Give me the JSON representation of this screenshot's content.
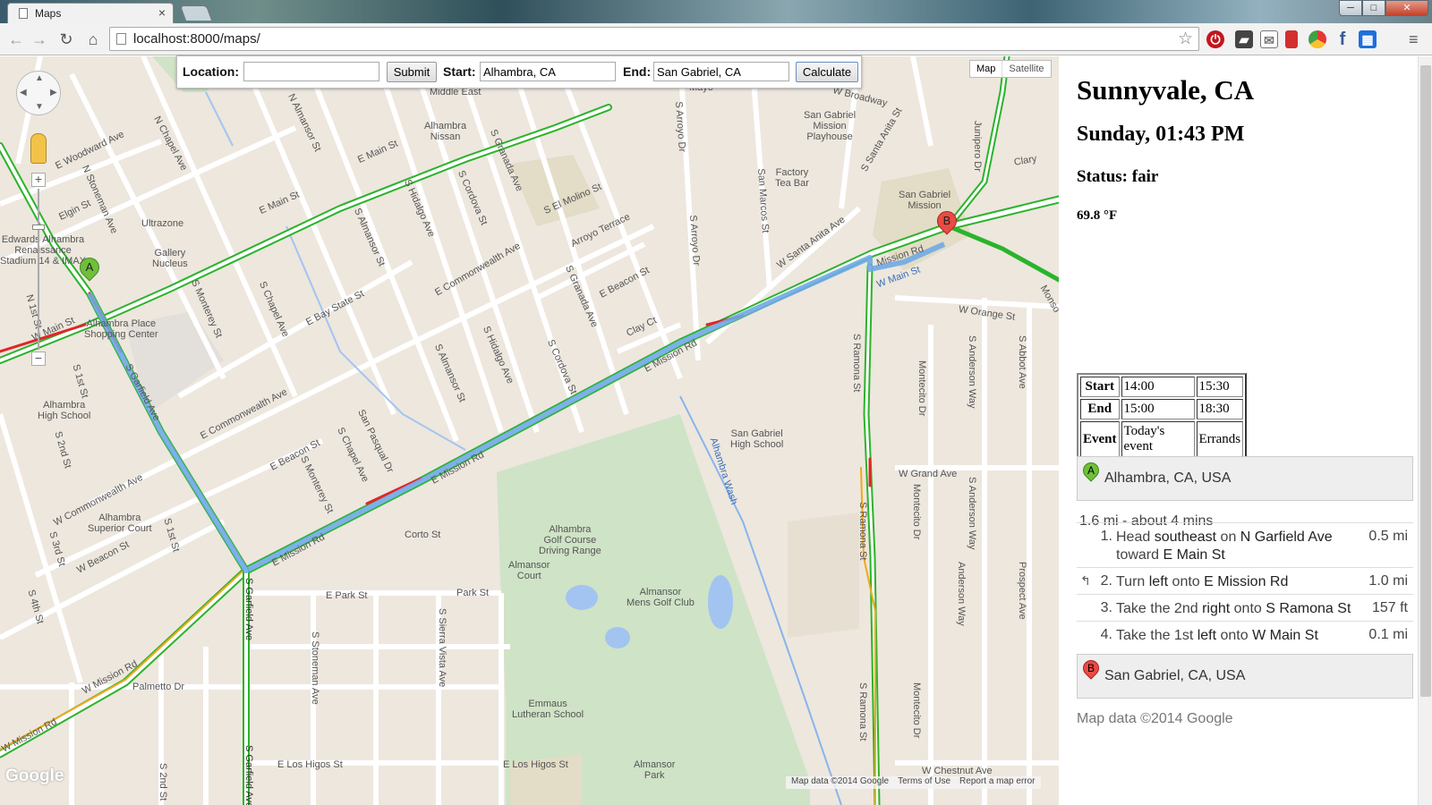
{
  "browser": {
    "tab_title": "Maps",
    "tab_close": "×",
    "url": "localhost:8000/maps/",
    "window_buttons": {
      "minimize": "─",
      "maximize": "□",
      "close": "✕"
    },
    "nav": {
      "back": "←",
      "forward": "→",
      "reload": "↻",
      "home": "⌂",
      "star": "☆",
      "menu": "≡"
    },
    "extensions": [
      "⏻",
      "▰",
      "✉",
      "",
      "",
      "f",
      "▦"
    ]
  },
  "form": {
    "location_label": "Location:",
    "location_value": "",
    "submit_label": "Submit",
    "start_label": "Start:",
    "start_value": "Alhambra, CA",
    "end_label": "End:",
    "end_value": "San Gabriel, CA",
    "calculate_label": "Calculate"
  },
  "map": {
    "type_buttons": {
      "map": "Map",
      "satellite": "Satellite"
    },
    "marker_a": "A",
    "marker_b": "B",
    "zoom_in": "+",
    "zoom_out": "−",
    "google_logo": "Google",
    "footer": {
      "data": "Map data ©2014 Google",
      "terms": "Terms of Use",
      "report": "Report a map error"
    },
    "streets": [
      {
        "text": "E Main St"
      },
      {
        "text": "E Main St"
      },
      {
        "text": "W Main St"
      },
      {
        "text": "E Mission Rd"
      },
      {
        "text": "E Mission Rd"
      },
      {
        "text": "E Mission Rd"
      },
      {
        "text": "Mission Rd"
      },
      {
        "text": "W Mission Rd"
      },
      {
        "text": "S Garfield Ave"
      },
      {
        "text": "E Woodward Ave"
      },
      {
        "text": "Elgin St"
      },
      {
        "text": "N Chapel Ave"
      },
      {
        "text": "N Almansor St"
      },
      {
        "text": "E Bay State St"
      },
      {
        "text": "E Commonwealth Ave"
      },
      {
        "text": "E Commonwealth Ave"
      },
      {
        "text": "W Commonwealth Ave"
      },
      {
        "text": "E Beacon St"
      },
      {
        "text": "E Beacon St"
      },
      {
        "text": "W Beacon St"
      },
      {
        "text": "Corto St"
      },
      {
        "text": "E Park St"
      },
      {
        "text": "Park St"
      },
      {
        "text": "Palmetto Dr"
      },
      {
        "text": "E Los Higos St"
      },
      {
        "text": "E Los Higos St"
      },
      {
        "text": "Arroyo Terrace"
      },
      {
        "text": "Clay Ct"
      },
      {
        "text": "S El Molino St"
      },
      {
        "text": "W Santa Anita Ave"
      },
      {
        "text": "S Santa Anita St"
      },
      {
        "text": "W Main St"
      },
      {
        "text": "W Orange St"
      },
      {
        "text": "W Grand Ave"
      },
      {
        "text": "W Chestnut Ave"
      },
      {
        "text": "S Ramona St"
      },
      {
        "text": "S Ramona St"
      },
      {
        "text": "S Ramona St"
      },
      {
        "text": "Montecito Dr"
      },
      {
        "text": "Montecito Dr"
      },
      {
        "text": "Montecito Dr"
      },
      {
        "text": "S Anderson Way"
      },
      {
        "text": "S Anderson Way"
      },
      {
        "text": "Anderson Way"
      },
      {
        "text": "S Abbot Ave"
      },
      {
        "text": "Prospect Ave"
      },
      {
        "text": "S Arroyo Dr"
      },
      {
        "text": "S Arroyo Dr"
      },
      {
        "text": "San Marcos St"
      },
      {
        "text": "Alhambra Wash"
      },
      {
        "text": "S Chapel Ave"
      },
      {
        "text": "S Hidalgo Ave"
      },
      {
        "text": "S Cordova St"
      },
      {
        "text": "S Granada Ave"
      },
      {
        "text": "S Almansor St"
      },
      {
        "text": "S Monterey St"
      },
      {
        "text": "S Stoneman Ave"
      },
      {
        "text": "S Sierra Vista Ave"
      },
      {
        "text": "S Garfield Ave"
      },
      {
        "text": "N 1st St"
      },
      {
        "text": "S 1st St"
      },
      {
        "text": "S 2nd St"
      },
      {
        "text": "S 3rd St"
      },
      {
        "text": "S 4th St"
      },
      {
        "text": "S 1st St"
      },
      {
        "text": "S 2nd St"
      },
      {
        "text": "San Pasqual Dr"
      },
      {
        "text": "S Chapel Ave"
      },
      {
        "text": "N Stoneman Ave"
      },
      {
        "text": "W Broadway"
      },
      {
        "text": "Clary"
      },
      {
        "text": "Junipero Dr"
      },
      {
        "text": "Monso"
      },
      {
        "text": "S Monterey St"
      },
      {
        "text": "S Almansor St"
      },
      {
        "text": "S Hidalgo Ave"
      },
      {
        "text": "S Cordova St"
      },
      {
        "text": "S Granada Ave"
      },
      {
        "text": "W Mission Rd"
      },
      {
        "text": "S Garfield Ave"
      }
    ],
    "pois": [
      {
        "text": "Middle East"
      },
      {
        "text": "Alhambra\nNissan"
      },
      {
        "text": "Ultrazone"
      },
      {
        "text": "Edwards Alhambra\nRenaissance\nStadium 14 & IMAX"
      },
      {
        "text": "Gallery\nNucleus"
      },
      {
        "text": "Alhambra Place\nShopping Center"
      },
      {
        "text": "Alhambra\nHigh School"
      },
      {
        "text": "Alhambra\nSuperior Court"
      },
      {
        "text": "San Gabriel\nMission\nPlayhouse"
      },
      {
        "text": "Factory\nTea Bar"
      },
      {
        "text": "San Gabriel\nMission"
      },
      {
        "text": "San Gabriel\nHigh School"
      },
      {
        "text": "Alhambra\nGolf Course\nDriving Range"
      },
      {
        "text": "Almansor\nCourt"
      },
      {
        "text": "Almansor\nMens Golf Club"
      },
      {
        "text": "Emmaus\nLutheran School"
      },
      {
        "text": "Almansor\nPark"
      },
      {
        "text": "Mayo"
      }
    ]
  },
  "panel": {
    "city": "Sunnyvale, CA",
    "datetime": "Sunday, 01:43 PM",
    "status": "Status: fair",
    "temperature": "69.8 °F",
    "schedule": {
      "start_label": "Start",
      "start_1": "14:00",
      "start_2": "15:30",
      "end_label": "End",
      "end_1": "15:00",
      "end_2": "18:30",
      "event_label": "Event",
      "event_1": "Today's event",
      "event_2": "Errands"
    },
    "origin": {
      "letter": "A",
      "address": "Alhambra, CA, USA"
    },
    "summary": "1.6 mi - about 4 mins",
    "steps": [
      {
        "num": "1.",
        "icon": "",
        "pre": "Head ",
        "b1": "southeast",
        "mid": " on ",
        "b2": "N Garfield Ave",
        "mid2": " toward ",
        "b3": "E Main St",
        "dist": "0.5 mi"
      },
      {
        "num": "2.",
        "icon": "↰",
        "pre": "Turn ",
        "b1": "left",
        "mid": " onto ",
        "b2": "E Mission Rd",
        "mid2": "",
        "b3": "",
        "dist": "1.0 mi"
      },
      {
        "num": "3.",
        "icon": "",
        "pre": "Take the 2nd ",
        "b1": "right",
        "mid": " onto ",
        "b2": "S Ramona St",
        "mid2": "",
        "b3": "",
        "dist": "157 ft"
      },
      {
        "num": "4.",
        "icon": "",
        "pre": "Take the 1st ",
        "b1": "left",
        "mid": " onto ",
        "b2": "W Main St",
        "mid2": "",
        "b3": "",
        "dist": "0.1 mi"
      }
    ],
    "destination": {
      "letter": "B",
      "address": "San Gabriel, CA, USA"
    },
    "copyright": "Map data ©2014 Google"
  },
  "colors": {
    "traffic_green": "#2bb32b",
    "traffic_orange": "#f2a71b",
    "traffic_red": "#e02626",
    "route_blue": "#6fa8e6",
    "park_green": "#cfe3c6",
    "water_blue": "#a3c4f1",
    "land": "#ede7de"
  }
}
